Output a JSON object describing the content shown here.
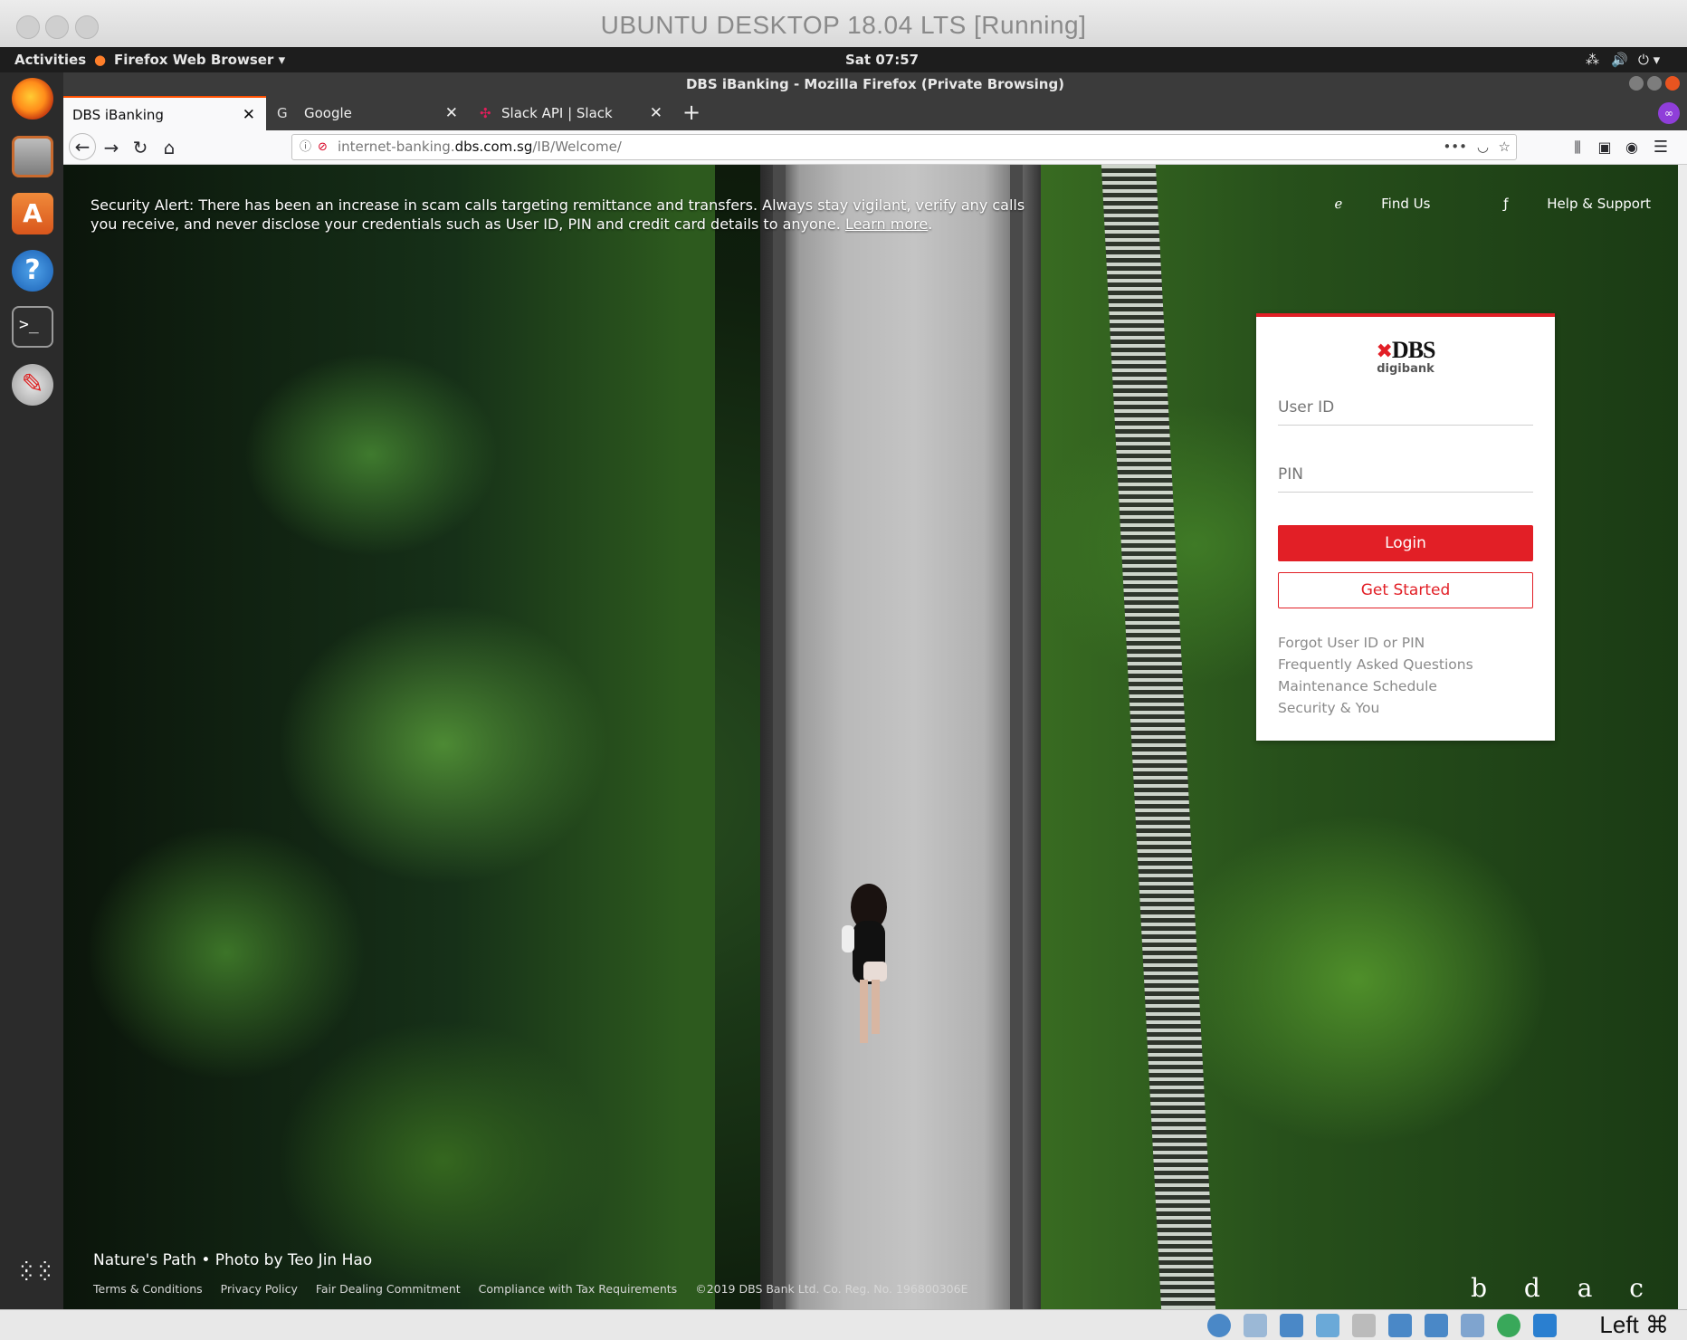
{
  "vm_window": {
    "title": "UBUNTU DESKTOP 18.04 LTS [Running]"
  },
  "topbar": {
    "activities": "Activities",
    "app_menu": "Firefox Web Browser",
    "clock": "Sat 07:57"
  },
  "firefox": {
    "window_title": "DBS iBanking - Mozilla Firefox (Private Browsing)",
    "tabs": [
      {
        "label": "DBS iBanking",
        "active": true
      },
      {
        "label": "Google",
        "active": false
      },
      {
        "label": "Slack API | Slack",
        "active": false
      }
    ],
    "url": {
      "prefix": "internet-banking.",
      "domain": "dbs.com.sg",
      "path": "/IB/Welcome/"
    }
  },
  "page": {
    "security_alert": "Security Alert: There has been an increase in scam calls targeting remittance and transfers. Always stay vigilant, verify any calls you receive, and never disclose your credentials such as User ID, PIN and credit card details to anyone.",
    "learn_more": "Learn more",
    "top_links": {
      "find_us": "Find Us",
      "help_support": "Help & Support"
    },
    "login_card": {
      "brand": "DBS",
      "sub_brand": "digibank",
      "user_id_placeholder": "User ID",
      "pin_placeholder": "PIN",
      "login_button": "Login",
      "get_started_button": "Get Started",
      "links": [
        "Forgot User ID or PIN",
        "Frequently Asked Questions",
        "Maintenance Schedule",
        "Security & You"
      ]
    },
    "photo_credit": "Nature's Path • Photo by Teo Jin Hao",
    "footer_links": [
      "Terms & Conditions",
      "Privacy Policy",
      "Fair Dealing Commitment",
      "Compliance with Tax Requirements"
    ],
    "copyright": "©2019 DBS Bank Ltd. Co. Reg. No. 196800306E",
    "footer_letters": "b d a c"
  },
  "status_bar": {
    "host_key": "Left ⌘"
  },
  "colors": {
    "dbs_red": "#e21f26",
    "firefox_accent": "#ff4f00"
  }
}
